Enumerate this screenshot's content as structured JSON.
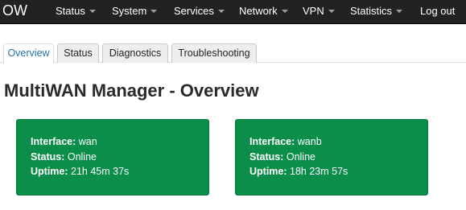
{
  "navbar": {
    "brand": "OW",
    "items": [
      {
        "label": "Status"
      },
      {
        "label": "System"
      },
      {
        "label": "Services"
      },
      {
        "label": "Network"
      },
      {
        "label": "VPN"
      },
      {
        "label": "Statistics"
      },
      {
        "label": "Log out"
      }
    ]
  },
  "tabs": [
    {
      "label": "Overview",
      "active": true
    },
    {
      "label": "Status"
    },
    {
      "label": "Diagnostics"
    },
    {
      "label": "Troubleshooting"
    }
  ],
  "page": {
    "title": "MultiWAN Manager - Overview"
  },
  "interfaces": [
    {
      "interface_label": "Interface:",
      "interface": "wan",
      "status_label": "Status:",
      "status": "Online",
      "uptime_label": "Uptime:",
      "uptime": "21h 45m 37s"
    },
    {
      "interface_label": "Interface:",
      "interface": "wanb",
      "status_label": "Status:",
      "status": "Online",
      "uptime_label": "Uptime:",
      "uptime": "18h 23m 57s"
    }
  ],
  "colors": {
    "navbar_bg": "#222222",
    "online_green": "#0b8e4a",
    "active_tab_text": "#2372a8"
  }
}
